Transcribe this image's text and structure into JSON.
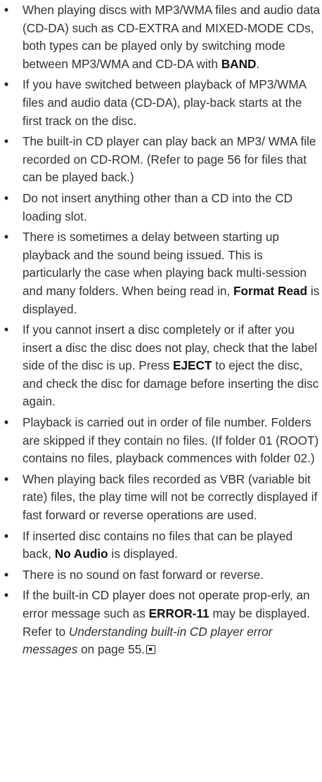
{
  "notes": [
    {
      "parts": [
        "When playing discs with MP3/WMA files and audio data (CD-DA) such as CD-EXTRA and MIXED-MODE CDs, both types can be played only by switching mode between MP3/WMA and CD-DA with ",
        "BAND",
        "."
      ]
    },
    {
      "parts": [
        "If you have switched between playback of MP3/WMA files and audio data (CD-DA), play-back starts at the first track on the disc."
      ]
    },
    {
      "parts": [
        "The built-in CD player can play back an MP3/ WMA file recorded on CD-ROM. (Refer to page 56 for files that can be played back.)"
      ]
    },
    {
      "parts": [
        "Do not insert anything other than a CD into the CD loading slot."
      ]
    },
    {
      "parts": [
        "There is sometimes a delay between starting up playback and the sound being issued. This is particularly the case when playing back multi-session and many folders. When being read in, ",
        "Format Read",
        " is displayed."
      ]
    },
    {
      "parts": [
        "If you cannot insert a disc completely or if after you insert a disc the disc does not play, check that the label side of the disc is up. Press ",
        "EJECT",
        " to eject the disc, and check the disc for damage before inserting the disc again."
      ]
    },
    {
      "parts": [
        "Playback is carried out in order of file number. Folders are skipped if they contain no files. (If folder 01 (ROOT) contains no files, playback commences with folder 02.)"
      ]
    },
    {
      "parts": [
        "When playing back files recorded as VBR (variable bit rate) files, the play time will not be correctly displayed if fast forward or reverse operations are used."
      ]
    },
    {
      "parts": [
        "If inserted disc contains no files that can be played back, ",
        "No Audio",
        " is displayed."
      ]
    },
    {
      "parts": [
        "There is no sound on fast forward or reverse."
      ]
    },
    {
      "parts": [
        "If the built-in CD player does not operate prop-erly, an error message such as ",
        "ERROR-11",
        " may be displayed. Refer to ",
        "Understanding built-in CD player error messages",
        " on page 55."
      ]
    }
  ],
  "bullet_glyph": "•",
  "end_mark_icon": "end-of-section-icon"
}
